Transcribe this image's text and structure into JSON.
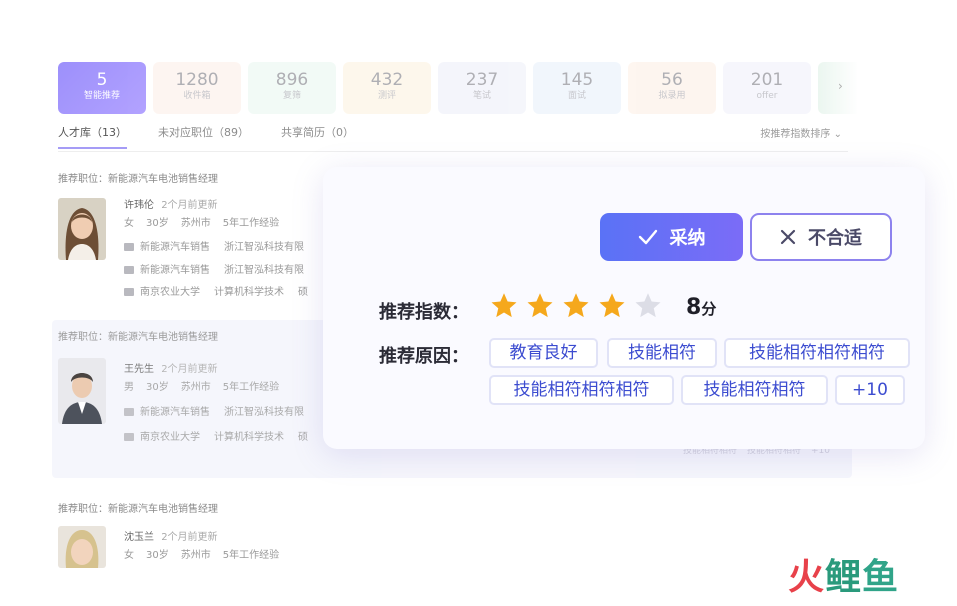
{
  "stats": [
    {
      "num": "5",
      "label": "智能推荐"
    },
    {
      "num": "1280",
      "label": "收件箱"
    },
    {
      "num": "896",
      "label": "复筛"
    },
    {
      "num": "432",
      "label": "测评"
    },
    {
      "num": "237",
      "label": "笔试"
    },
    {
      "num": "145",
      "label": "面试"
    },
    {
      "num": "56",
      "label": "拟录用"
    },
    {
      "num": "201",
      "label": "offer"
    }
  ],
  "stats_next_icon": "chevron-right-icon",
  "stats_next_glyph": "›",
  "subtabs": [
    {
      "label": "人才库（13）"
    },
    {
      "label": "未对应职位（89）"
    },
    {
      "label": "共享简历（0）"
    }
  ],
  "sort": {
    "label": "按推荐指数排序",
    "arrow": "⌄"
  },
  "candidates": [
    {
      "rec_label": "推荐职位：新能源汽车电池销售经理",
      "name": "许玮伦",
      "updated": "2个月前更新",
      "gender": "女",
      "age": "30岁",
      "city": "苏州市",
      "exp": "5年工作经验",
      "job1": {
        "title": "新能源汽车销售",
        "company": "浙江智泓科技有限"
      },
      "job2": {
        "title": "新能源汽车销售",
        "company": "浙江智泓科技有限"
      },
      "edu": {
        "school": "南京农业大学",
        "major": "计算机科学技术",
        "degree": "硕"
      }
    },
    {
      "rec_label": "推荐职位：新能源汽车电池销售经理",
      "name": "王先生",
      "updated": "2个月前更新",
      "gender": "男",
      "age": "30岁",
      "city": "苏州市",
      "exp": "5年工作经验",
      "job1": {
        "title": "新能源汽车销售",
        "company": "浙江智泓科技有限"
      },
      "edu": {
        "school": "南京农业大学",
        "major": "计算机科学技术",
        "degree": "硕"
      },
      "ghost_tags": [
        "技能相符相符",
        "技能相符相符",
        "+10"
      ]
    },
    {
      "rec_label": "推荐职位：新能源汽车电池销售经理",
      "name": "沈玉兰",
      "updated": "2个月前更新",
      "gender": "女",
      "age": "30岁",
      "city": "苏州市",
      "exp": "5年工作经验"
    }
  ],
  "overlay": {
    "accept_label": "采纳",
    "reject_label": "不合适",
    "score_label": "推荐指数：",
    "rating": 4,
    "rating_max": 5,
    "score_value": "8",
    "score_unit": "分",
    "reasons_label": "推荐原因：",
    "reasons": [
      "教育良好",
      "技能相符",
      "技能相符相符相符",
      "技能相符相符相符",
      "技能相符相符",
      "+10"
    ]
  },
  "colors": {
    "accent": "#7b6cf7",
    "star_filled": "#f5a81c",
    "star_empty": "#dcdde6",
    "tag_text": "#3c4cd0"
  },
  "logo": {
    "char1": "火",
    "char2": "鲤",
    "char3": "鱼"
  }
}
